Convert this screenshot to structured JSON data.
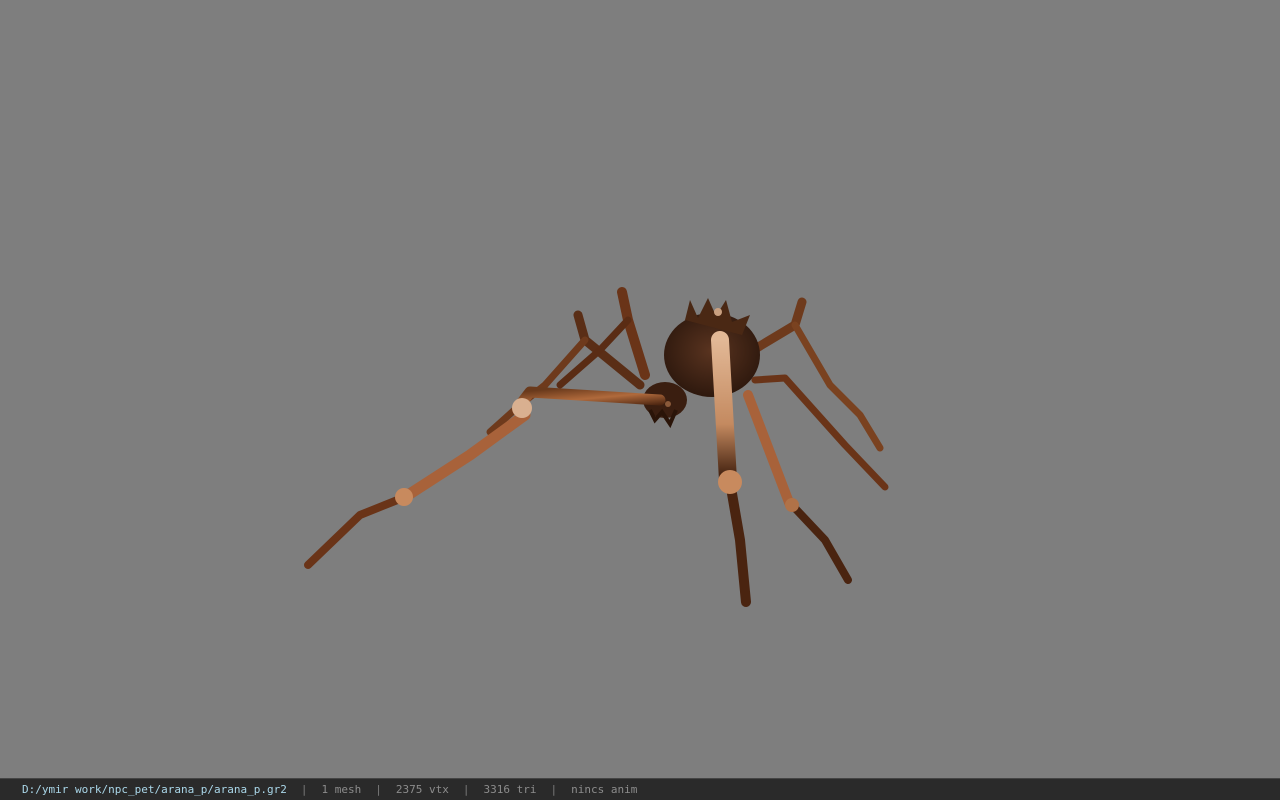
{
  "viewer": {
    "background_color": "#7e7e7e",
    "model_icon": "spider-model-icon"
  },
  "statusbar": {
    "file_path": "D:/ymir work/npc_pet/arana_p/arana_p.gr2",
    "separator": "|",
    "mesh_count": "1 mesh",
    "vertex_count": "2375 vtx",
    "triangle_count": "3316 tri",
    "animation": "nincs anim",
    "path_color": "#a9d6e8"
  }
}
